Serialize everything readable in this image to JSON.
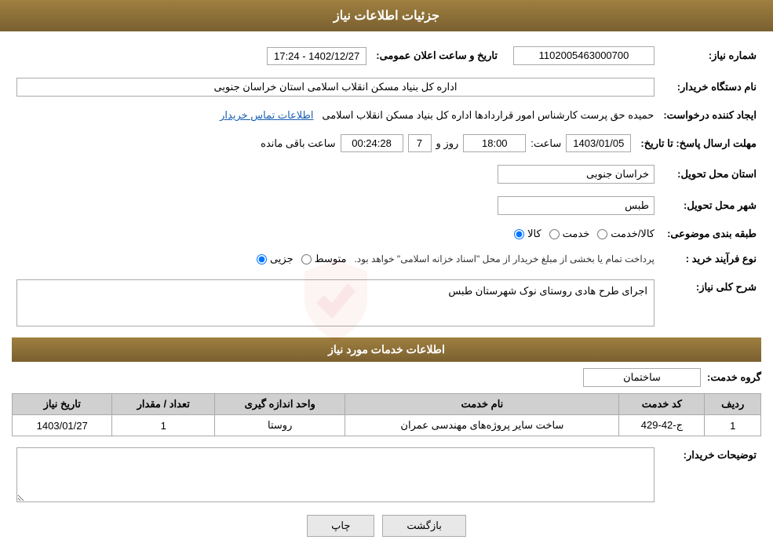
{
  "page": {
    "title": "جزئیات اطلاعات نیاز",
    "header": "جزئیات اطلاعات نیاز"
  },
  "fields": {
    "need_number_label": "شماره نیاز:",
    "need_number_value": "1102005463000700",
    "announcement_date_label": "تاریخ و ساعت اعلان عمومی:",
    "announcement_date_value": "1402/12/27 - 17:24",
    "buyer_org_label": "نام دستگاه خریدار:",
    "buyer_org_value": "اداره کل بنیاد مسکن انقلاب اسلامی استان خراسان جنوبی",
    "requester_label": "ایجاد کننده درخواست:",
    "requester_value": "حمیده حق پرست کارشناس امور قراردادها اداره کل بنیاد مسکن انقلاب اسلامی",
    "requester_contact_link": "اطلاعات تماس خریدار",
    "response_date_label": "مهلت ارسال پاسخ: تا تاریخ:",
    "response_date_value": "1403/01/05",
    "response_time_label": "ساعت:",
    "response_time_value": "18:00",
    "response_days_label": "روز و",
    "response_days_value": "7",
    "remaining_time_label": "ساعت باقی مانده",
    "remaining_time_value": "00:24:28",
    "delivery_province_label": "استان محل تحویل:",
    "delivery_province_value": "خراسان جنوبی",
    "delivery_city_label": "شهر محل تحویل:",
    "delivery_city_value": "طبس",
    "category_label": "طبقه بندی موضوعی:",
    "category_options": [
      {
        "label": "کالا",
        "checked": false
      },
      {
        "label": "خدمت",
        "checked": false
      },
      {
        "label": "کالا/خدمت",
        "checked": false
      }
    ],
    "process_label": "نوع فرآیند خرید :",
    "process_options": [
      {
        "label": "جزیی",
        "checked": false
      },
      {
        "label": "متوسط",
        "checked": false
      }
    ],
    "process_note": "پرداخت تمام یا بخشی از مبلغ خریدار از محل \"اسناد خزانه اسلامی\" خواهد بود.",
    "description_label": "شرح کلی نیاز:",
    "description_value": "اجرای طرح هادی روستای نوک شهرستان طبس",
    "services_section_label": "اطلاعات خدمات مورد نیاز",
    "service_group_label": "گروه خدمت:",
    "service_group_value": "ساختمان",
    "table": {
      "headers": [
        "ردیف",
        "کد خدمت",
        "نام خدمت",
        "واحد اندازه گیری",
        "تعداد / مقدار",
        "تاریخ نیاز"
      ],
      "rows": [
        {
          "row_num": "1",
          "service_code": "ج-42-429",
          "service_name": "ساخت سایر پروژه‌های مهندسی عمران",
          "unit": "روستا",
          "quantity": "1",
          "date": "1403/01/27"
        }
      ]
    },
    "buyer_description_label": "توضیحات خریدار:",
    "buyer_description_value": "",
    "buttons": {
      "print": "چاپ",
      "back": "بازگشت"
    }
  }
}
